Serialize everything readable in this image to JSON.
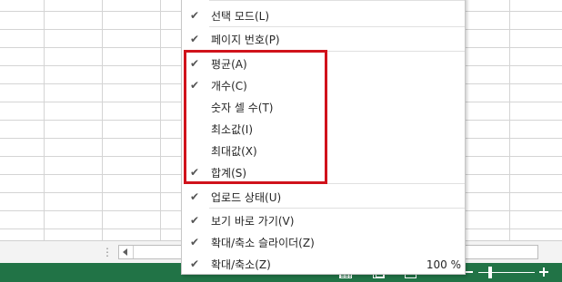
{
  "sheet_tabs": {
    "more_label": "⋮"
  },
  "menu": {
    "items": [
      {
        "label": "선택 모드(L)",
        "checked": true
      },
      {
        "label": "페이지 번호(P)",
        "checked": true
      },
      {
        "label": "평균(A)",
        "checked": true
      },
      {
        "label": "개수(C)",
        "checked": true
      },
      {
        "label": "숫자 셀 수(T)",
        "checked": false
      },
      {
        "label": "최소값(I)",
        "checked": false
      },
      {
        "label": "최대값(X)",
        "checked": false
      },
      {
        "label": "합계(S)",
        "checked": true
      },
      {
        "label": "업로드 상태(U)",
        "checked": true
      },
      {
        "label": "보기 바로 가기(V)",
        "checked": true
      },
      {
        "label": "확대/축소 슬라이더(Z)",
        "checked": true
      },
      {
        "label": "확대/축소(Z)",
        "checked": true,
        "value": "100 %"
      }
    ],
    "check_glyph": "✔"
  },
  "status_bar": {
    "views": [
      "normal-view-icon",
      "page-layout-view-icon",
      "page-break-view-icon"
    ],
    "zoom_percent": 100
  },
  "colors": {
    "status_bar": "#217346",
    "highlight": "#d0121b"
  }
}
